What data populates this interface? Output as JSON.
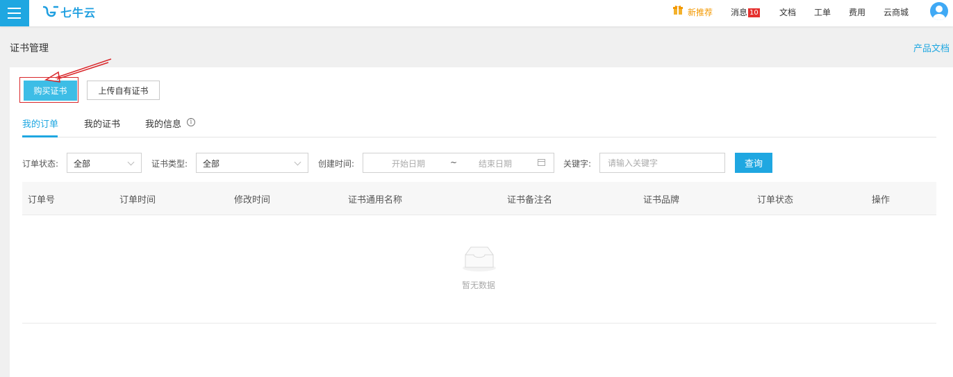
{
  "header": {
    "logo_text": "七牛云",
    "nav": {
      "promo": "新推荐",
      "messages": "消息",
      "messages_count": "10",
      "docs": "文档",
      "tickets": "工单",
      "billing": "费用",
      "marketplace": "云商城"
    }
  },
  "page": {
    "title": "证书管理",
    "doc_link": "产品文档"
  },
  "actions": {
    "buy": "购买证书",
    "upload": "上传自有证书"
  },
  "tabs": [
    {
      "label": "我的订单",
      "active": true
    },
    {
      "label": "我的证书",
      "active": false
    },
    {
      "label": "我的信息",
      "active": false
    }
  ],
  "filters": {
    "status_label": "订单状态:",
    "status_value": "全部",
    "type_label": "证书类型:",
    "type_value": "全部",
    "created_label": "创建时间:",
    "start_placeholder": "开始日期",
    "range_sep": "~",
    "end_placeholder": "结束日期",
    "keyword_label": "关键字:",
    "keyword_placeholder": "请输入关键字",
    "query": "查询"
  },
  "table": {
    "columns": [
      "订单号",
      "订单时间",
      "修改时间",
      "证书通用名称",
      "证书备注名",
      "证书品牌",
      "订单状态",
      "操作"
    ],
    "rows": [],
    "empty_text": "暂无数据"
  },
  "colors": {
    "accent": "#1fa7e1",
    "buy_button": "#3dbde6",
    "promo": "#f39800",
    "badge": "#e5302e",
    "annotation": "#d9262a"
  }
}
